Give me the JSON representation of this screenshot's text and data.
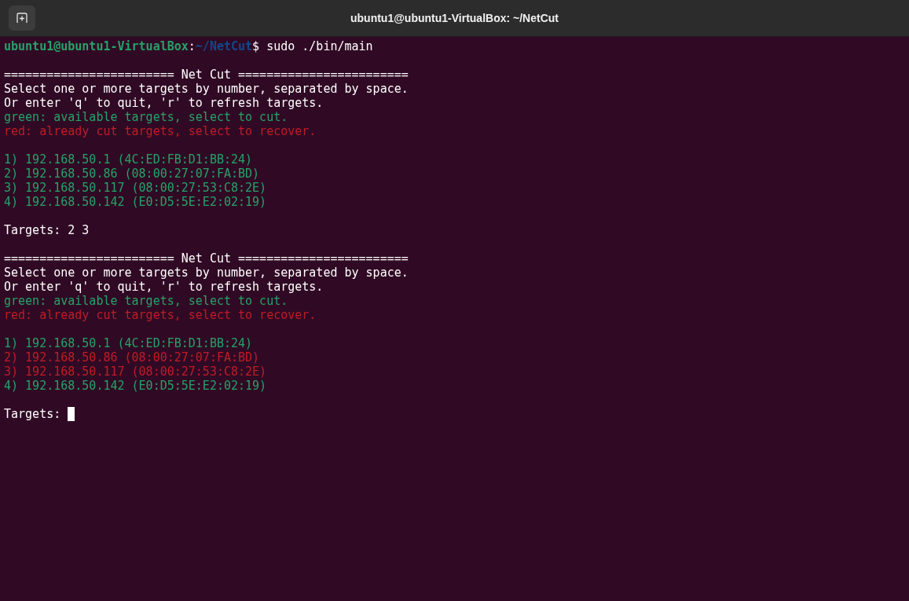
{
  "window": {
    "title": "ubuntu1@ubuntu1-VirtualBox: ~/NetCut"
  },
  "prompt": {
    "user_host": "ubuntu1@ubuntu1-VirtualBox",
    "separator": ":",
    "path": "~/NetCut",
    "symbol": "$",
    "command": " sudo ./bin/main"
  },
  "blocks": [
    {
      "banner": "======================== Net Cut ========================",
      "instructions": [
        "Select one or more targets by number, separated by space.",
        "Or enter 'q' to quit, 'r' to refresh targets."
      ],
      "legend": [
        {
          "text": "green: available targets, select to cut.",
          "cut": false
        },
        {
          "text": "red: already cut targets, select to recover.",
          "cut": true
        }
      ],
      "targets": [
        {
          "text": "1) 192.168.50.1 (4C:ED:FB:D1:BB:24)",
          "cut": false
        },
        {
          "text": "2) 192.168.50.86 (08:00:27:07:FA:BD)",
          "cut": false
        },
        {
          "text": "3) 192.168.50.117 (08:00:27:53:C8:2E)",
          "cut": false
        },
        {
          "text": "4) 192.168.50.142 (E0:D5:5E:E2:02:19)",
          "cut": false
        }
      ],
      "input": {
        "label": "Targets:",
        "value": "2 3",
        "cursor": false
      }
    },
    {
      "banner": "======================== Net Cut ========================",
      "instructions": [
        "Select one or more targets by number, separated by space.",
        "Or enter 'q' to quit, 'r' to refresh targets."
      ],
      "legend": [
        {
          "text": "green: available targets, select to cut.",
          "cut": false
        },
        {
          "text": "red: already cut targets, select to recover.",
          "cut": true
        }
      ],
      "targets": [
        {
          "text": "1) 192.168.50.1 (4C:ED:FB:D1:BB:24)",
          "cut": false
        },
        {
          "text": "2) 192.168.50.86 (08:00:27:07:FA:BD)",
          "cut": true
        },
        {
          "text": "3) 192.168.50.117 (08:00:27:53:C8:2E)",
          "cut": true
        },
        {
          "text": "4) 192.168.50.142 (E0:D5:5E:E2:02:19)",
          "cut": false
        }
      ],
      "input": {
        "label": "Targets:",
        "cursor": true
      }
    }
  ]
}
